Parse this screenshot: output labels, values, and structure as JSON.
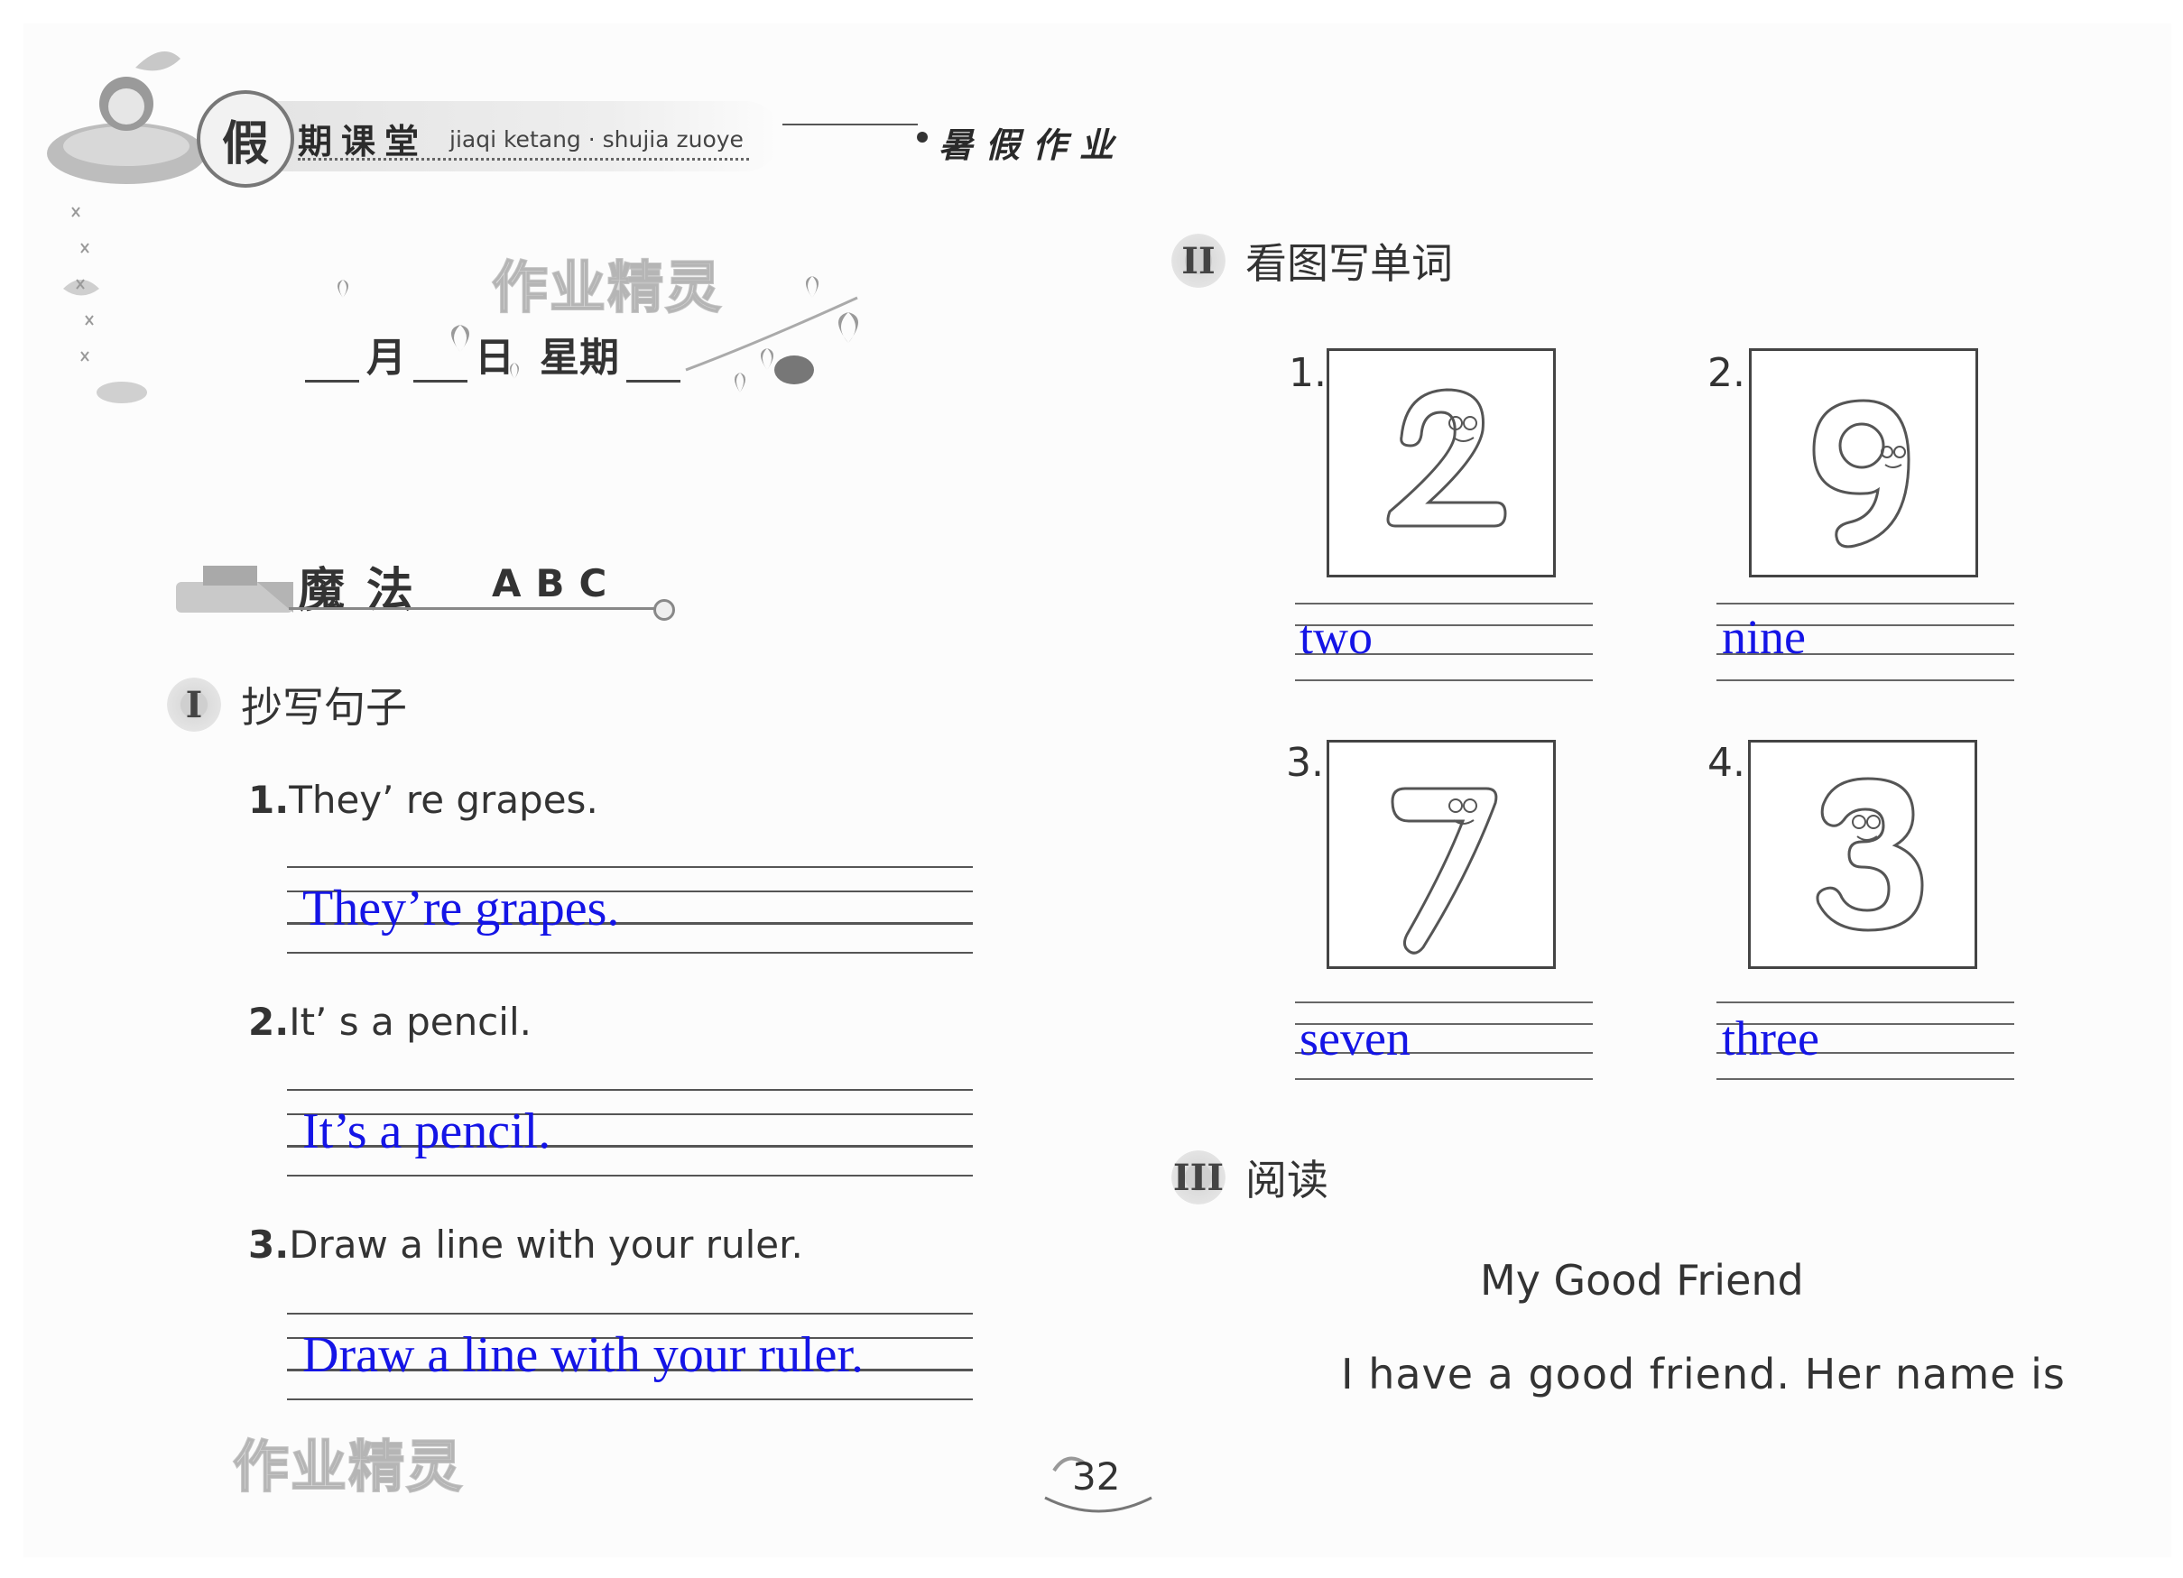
{
  "header": {
    "badge": "假",
    "title": "期课堂",
    "pinyin": "jiaqi ketang · shujia zuoye",
    "right_title": "暑假作业"
  },
  "watermark": "作业精灵",
  "date_line": {
    "month": "月",
    "day": "日",
    "weekday": "星期"
  },
  "magic_section": {
    "title": "魔法",
    "letters": "ABC"
  },
  "section1": {
    "numeral": "I",
    "heading": "抄写句子",
    "items": [
      {
        "num": "1.",
        "prompt": "They’ re grapes.",
        "answer": "They’re grapes."
      },
      {
        "num": "2.",
        "prompt": "It’ s a pencil.",
        "answer": "It’s a pencil."
      },
      {
        "num": "3.",
        "prompt": "Draw a line with your ruler.",
        "answer": "Draw a line with your ruler."
      }
    ]
  },
  "section2": {
    "numeral": "II",
    "heading": "看图写单词",
    "items": [
      {
        "num": "1.",
        "digit": "2",
        "answer": "two"
      },
      {
        "num": "2.",
        "digit": "9",
        "answer": "nine"
      },
      {
        "num": "3.",
        "digit": "7",
        "answer": "seven"
      },
      {
        "num": "4.",
        "digit": "3",
        "answer": "three"
      }
    ]
  },
  "section3": {
    "numeral": "III",
    "heading": "阅读",
    "title": "My Good Friend",
    "text": "I have a good friend. Her name is"
  },
  "page_number": "32",
  "colors": {
    "answer": "#1414e6",
    "ink": "#333333"
  }
}
